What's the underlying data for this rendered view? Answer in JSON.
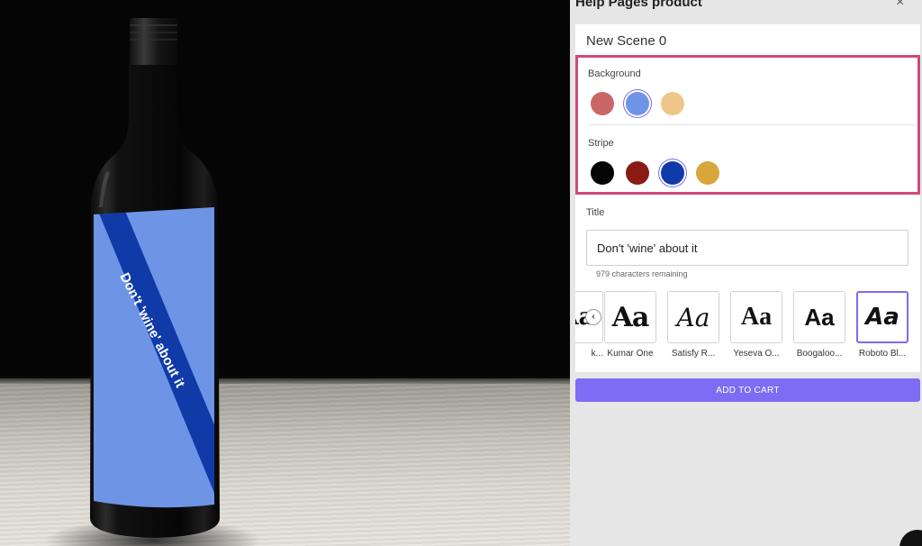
{
  "panel": {
    "title": "Help Pages product",
    "close_icon": "×",
    "scene_name": "New Scene 0"
  },
  "background": {
    "label": "Background",
    "swatches": [
      {
        "name": "rose",
        "color": "#c96767"
      },
      {
        "name": "blue",
        "color": "#6e94e6",
        "selected": true
      },
      {
        "name": "sand",
        "color": "#eec68a"
      }
    ]
  },
  "stripe": {
    "label": "Stripe",
    "swatches": [
      {
        "name": "black",
        "color": "#050505"
      },
      {
        "name": "red",
        "color": "#8a1b12"
      },
      {
        "name": "navy",
        "color": "#0f3aa8",
        "selected": true
      },
      {
        "name": "gold",
        "color": "#d8a63a"
      }
    ]
  },
  "title": {
    "label": "Title",
    "value": "Don't 'wine' about it",
    "chars_remaining": "979 characters remaining"
  },
  "fonts": {
    "prev_icon": "‹",
    "items": [
      {
        "name": "k...",
        "sample": "Aa"
      },
      {
        "name": "Kumar One",
        "sample": "Aa"
      },
      {
        "name": "Satisfy R...",
        "sample": "Aa"
      },
      {
        "name": "Yeseva O...",
        "sample": "Aa"
      },
      {
        "name": "Boogaloo...",
        "sample": "Aa"
      },
      {
        "name": "Roboto Bl...",
        "sample": "Aa",
        "selected": true
      }
    ]
  },
  "cart": {
    "label": "ADD TO CART"
  },
  "label_text": "Don't 'wine' about it",
  "colors": {
    "accent": "#7e6cf5",
    "highlight": "#d04a7e"
  }
}
